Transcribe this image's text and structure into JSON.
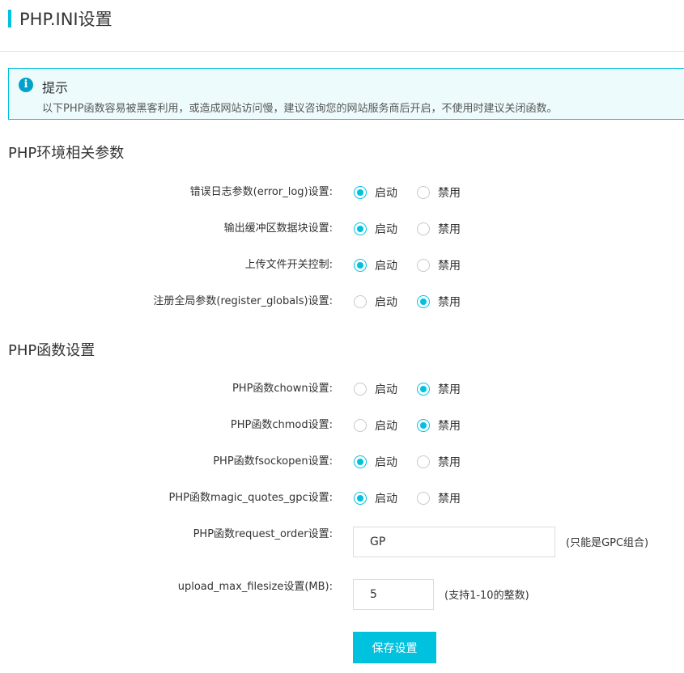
{
  "page": {
    "title": "PHP.INI设置"
  },
  "notice": {
    "title": "提示",
    "text": "以下PHP函数容易被黑客利用，或造成网站访问慢，建议咨询您的网站服务商后开启，不使用时建议关闭函数。"
  },
  "options": {
    "enable": "启动",
    "disable": "禁用"
  },
  "colors": {
    "accent": "#00c1de",
    "notice_bg": "#eefbfd",
    "info_icon": "#00a2ca"
  },
  "env_section": {
    "title": "PHP环境相关参数",
    "rows": [
      {
        "label": "错误日志参数(error_log)设置:",
        "selected": "enable"
      },
      {
        "label": "输出缓冲区数据块设置:",
        "selected": "enable"
      },
      {
        "label": "上传文件开关控制:",
        "selected": "enable"
      },
      {
        "label": "注册全局参数(register_globals)设置:",
        "selected": "disable"
      }
    ]
  },
  "func_section": {
    "title": "PHP函数设置",
    "rows": [
      {
        "label": "PHP函数chown设置:",
        "selected": "disable"
      },
      {
        "label": "PHP函数chmod设置:",
        "selected": "disable"
      },
      {
        "label": "PHP函数fsockopen设置:",
        "selected": "enable"
      },
      {
        "label": "PHP函数magic_quotes_gpc设置:",
        "selected": "enable"
      }
    ],
    "request_order": {
      "label": "PHP函数request_order设置:",
      "value": "GP",
      "hint": "(只能是GPC组合)"
    },
    "upload_max": {
      "label": "upload_max_filesize设置(MB):",
      "value": "5",
      "hint": "(支持1-10的整数)"
    }
  },
  "save_label": "保存设置"
}
